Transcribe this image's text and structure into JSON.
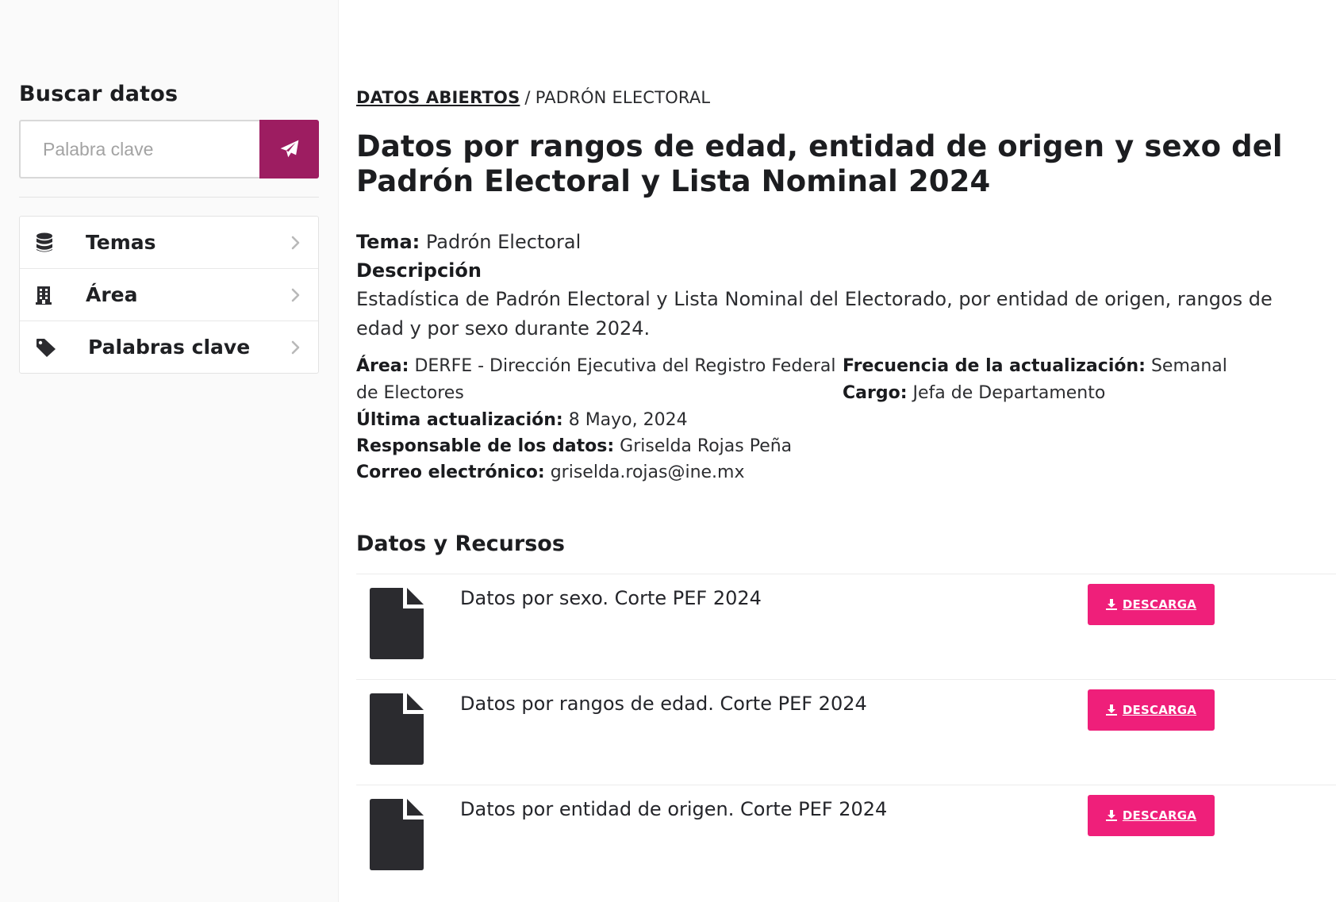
{
  "sidebar": {
    "title": "Buscar datos",
    "search": {
      "placeholder": "Palabra clave",
      "value": ""
    },
    "filters": [
      {
        "label": "Temas",
        "icon": "database-icon"
      },
      {
        "label": "Área",
        "icon": "building-icon"
      },
      {
        "label": "Palabras clave",
        "icon": "tag-icon"
      }
    ]
  },
  "breadcrumb": {
    "root": "DATOS ABIERTOS",
    "separator": "/",
    "current": "PADRÓN ELECTORAL"
  },
  "dataset": {
    "title": "Datos por rangos de edad, entidad de origen y sexo del Padrón Electoral y Lista Nominal 2024",
    "tema_label": "Tema:",
    "tema_value": "Padrón Electoral",
    "descripcion_label": "Descripción",
    "descripcion_text": "Estadística de Padrón Electoral y Lista Nominal del Electorado, por entidad de origen, rangos de edad y por sexo durante 2024.",
    "area_label": "Área:",
    "area_value": "DERFE - Dirección Ejecutiva del Registro Federal de Electores",
    "frecuencia_label": "Frecuencia de la actualización:",
    "frecuencia_value": "Semanal",
    "cargo_label": "Cargo:",
    "cargo_value": "Jefa de Departamento",
    "ultima_label": "Última actualización:",
    "ultima_value": "8 Mayo, 2024",
    "responsable_label": "Responsable de los datos:",
    "responsable_value": "Griselda Rojas Peña",
    "correo_label": "Correo electrónico:",
    "correo_value": "griselda.rojas@ine.mx"
  },
  "resources": {
    "title": "Datos y Recursos",
    "download_label": "DESCARGA",
    "items": [
      {
        "name": "Datos por sexo. Corte PEF 2024"
      },
      {
        "name": "Datos por rangos de edad. Corte PEF 2024"
      },
      {
        "name": "Datos por entidad de origen. Corte PEF 2024"
      }
    ]
  },
  "colors": {
    "search_button": "#9d1d61",
    "download_button": "#ef1f7a",
    "icon": "#2b2b2f"
  }
}
